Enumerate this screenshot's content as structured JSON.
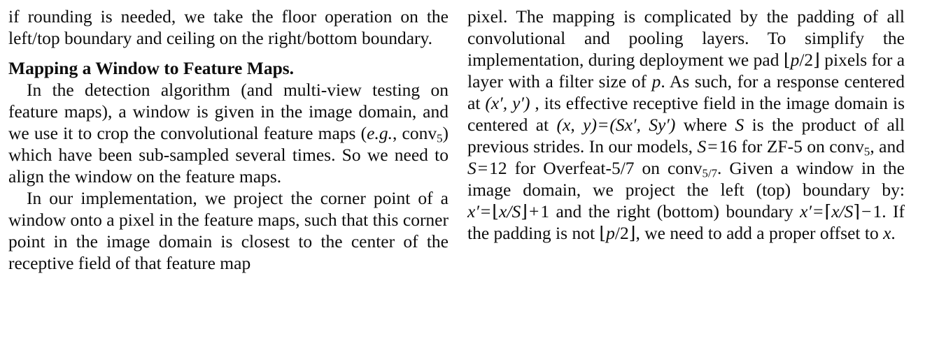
{
  "document": {
    "type": "academic-paper-two-column-excerpt",
    "background_color": "#ffffff",
    "text_color": "#0d0d0d",
    "columns": 2
  },
  "left_column": {
    "paragraphs": [
      {
        "id": "para-continued",
        "indent": false,
        "text": "if rounding is needed, we take the floor operation on the left/top boundary and ceiling on the right/bottom boundary."
      },
      {
        "id": "para-mapping-window",
        "heading": "Mapping a Window to Feature Maps.",
        "indent": true,
        "text_before_math": "In the detection algorithm (and multi-view testing on feature maps), a window is given in the image domain, and we use it to crop the convolutional feature maps (",
        "italic_eg": "e.g.",
        "text_after_eg": ", conv",
        "conv_subscript": "5",
        "text_after_math": ") which have been sub-sampled several times. So we need to align the window on the feature maps."
      },
      {
        "id": "para-implementation",
        "indent": true,
        "text": "In our implementation, we project the corner point of a window onto a pixel in the feature maps, such that this corner point in the image domain is closest to the center of the receptive field of that feature map"
      }
    ]
  },
  "right_column": {
    "paragraph": {
      "id": "para-pixel-mapping",
      "seg_1": "pixel. The mapping is complicated by the padding of all convolutional and pooling layers. To simplify the implementation, during deployment we pad ",
      "math_floor_p_open": "⌊",
      "math_p": "p",
      "math_slash_2": "/2",
      "math_floor_p_close": "⌋",
      "seg_2": " pixels for a layer with a filter size of ",
      "math_p2": "p",
      "seg_3": ". As such, for a response centered at ",
      "math_xprime_yprime": "(x′, y′)",
      "seg_4": " , its effective receptive field in the image domain is centered at ",
      "math_x_y": "(x, y)",
      "math_equals": "=",
      "math_Sxprime_Syprime": "(Sx′, Sy′)",
      "seg_5": " where ",
      "math_S": "S",
      "seg_6": " is the product of all previous strides. In our models, ",
      "math_S2": "S",
      "math_equals2": "=",
      "math_16": "16",
      "seg_7": " for ZF-5 on conv",
      "conv_sub_5": "5",
      "seg_8": ", and ",
      "math_S3": "S",
      "math_equals3": "=",
      "math_12": "12",
      "seg_9": " for Overfeat-5/7 on conv",
      "conv_sub_57": "5/7",
      "seg_10": ". Given a window in the image domain, we project the left (top) boundary by: ",
      "math_xprime": "x′",
      "math_equals4": "=",
      "math_floor_open": "⌊",
      "math_x_over_S": "x/S",
      "math_floor_close": "⌋",
      "math_plus": "+",
      "math_1": "1",
      "seg_11": " and the right (bottom) boundary ",
      "math_xprime2": "x′",
      "math_equals5": "=",
      "math_ceil_open": "⌈",
      "math_x_over_S2": "x/S",
      "math_ceil_close": "⌉",
      "math_minus": "−",
      "math_1b": "1",
      "seg_12": ". If the padding is not ",
      "math_floor_p2_open": "⌊",
      "math_p3": "p",
      "math_slash_2b": "/2",
      "math_floor_p2_close": "⌋",
      "seg_13": ", we need to add a proper offset to ",
      "math_x_final": "x",
      "seg_14": "."
    }
  }
}
